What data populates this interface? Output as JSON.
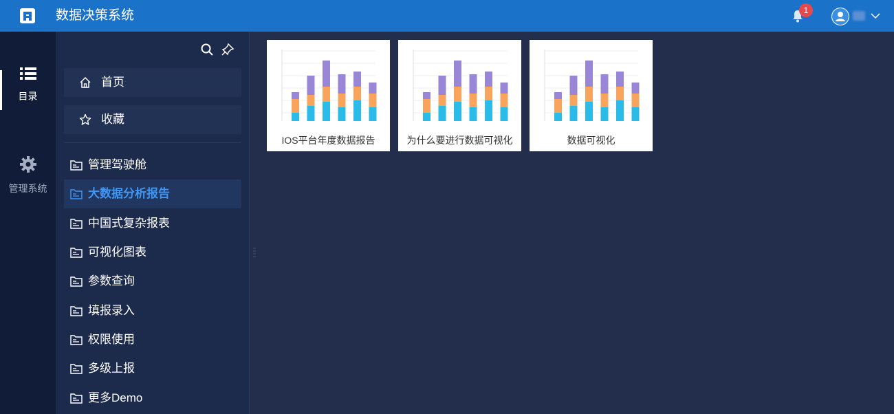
{
  "header": {
    "title": "数据决策系统",
    "notification_count": "1"
  },
  "rail": {
    "items": [
      {
        "label": "目录",
        "icon": "list-icon",
        "active": true
      },
      {
        "label": "管理系统",
        "icon": "gear-icon",
        "active": false
      }
    ]
  },
  "sidebar": {
    "quick": [
      {
        "label": "首页",
        "icon": "home-icon"
      },
      {
        "label": "收藏",
        "icon": "star-icon"
      }
    ],
    "folders": [
      {
        "label": "管理驾驶舱"
      },
      {
        "label": "大数据分析报告",
        "active": true
      },
      {
        "label": "中国式复杂报表"
      },
      {
        "label": "可视化图表"
      },
      {
        "label": "参数查询"
      },
      {
        "label": "填报录入"
      },
      {
        "label": "权限使用"
      },
      {
        "label": "多级上报"
      },
      {
        "label": "更多Demo"
      }
    ]
  },
  "cards": [
    {
      "title": "IOS平台年度数据报告"
    },
    {
      "title": "为什么要进行数据可视化"
    },
    {
      "title": "数据可视化"
    }
  ],
  "thumbnail": {
    "colors": {
      "blue": "#2bbbe8",
      "orange": "#f8a45c",
      "purple": "#9a86d6"
    },
    "stacks": [
      [
        12,
        20,
        10
      ],
      [
        22,
        16,
        28
      ],
      [
        28,
        22,
        38
      ],
      [
        20,
        20,
        28
      ],
      [
        30,
        20,
        22
      ],
      [
        20,
        20,
        16
      ]
    ]
  },
  "colors": {
    "topbar": "#1a72c9",
    "rail": "#111c38",
    "sidebar": "#1c2a4b",
    "main": "#222e4c",
    "active_text": "#3e96f5"
  }
}
